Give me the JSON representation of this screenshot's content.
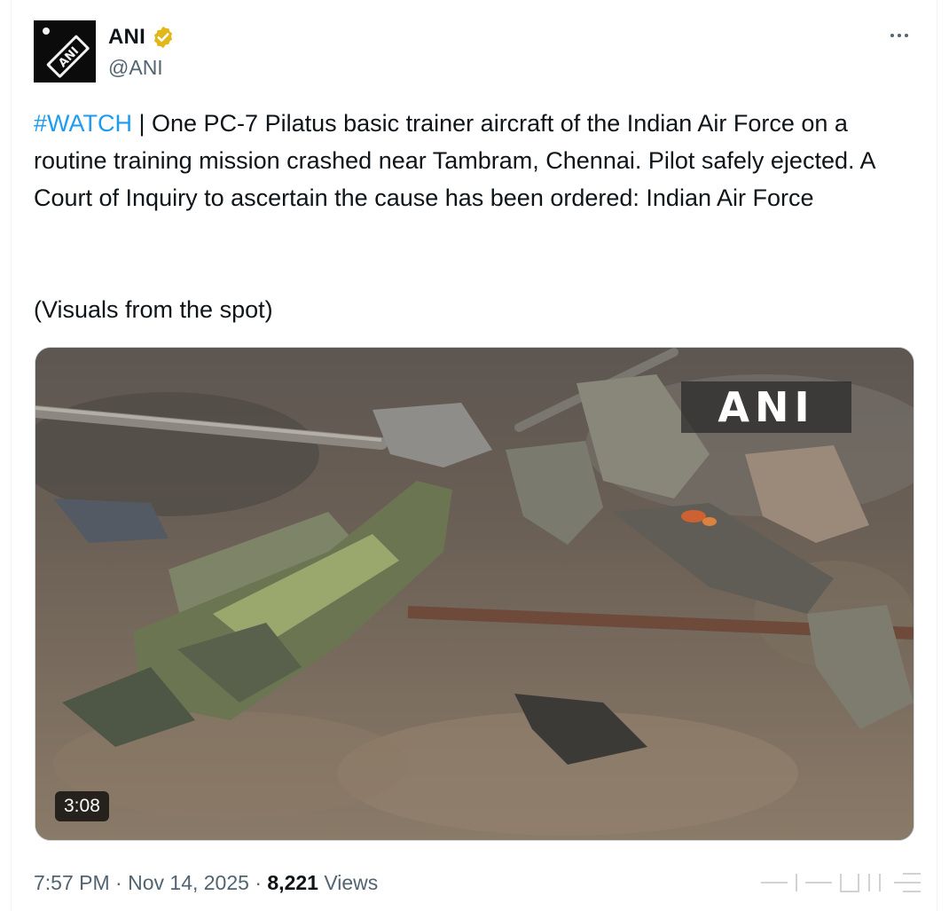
{
  "author": {
    "name": "ANI",
    "handle": "@ANI",
    "avatar_text": "ANI",
    "verified_color": "#e2b719"
  },
  "tweet": {
    "hashtag": "#WATCH",
    "body": " | One PC-7 Pilatus basic trainer aircraft of the Indian Air Force on a routine training mission crashed near Tambram, Chennai. Pilot safely ejected. A Court of Inquiry to ascertain the cause has been ordered: Indian Air Force",
    "visuals_note": "(Visuals from the spot)"
  },
  "media": {
    "watermark": "ANI",
    "duration": "3:08"
  },
  "meta": {
    "time": "7:57 PM",
    "separator": "·",
    "date": "Nov 14, 2025",
    "views_count": "8,221",
    "views_label": "Views"
  },
  "colors": {
    "link": "#1d9bf0",
    "secondary_text": "#536471",
    "primary_text": "#0f1419"
  },
  "icons": [
    "verified-badge-icon",
    "more-options-icon"
  ]
}
